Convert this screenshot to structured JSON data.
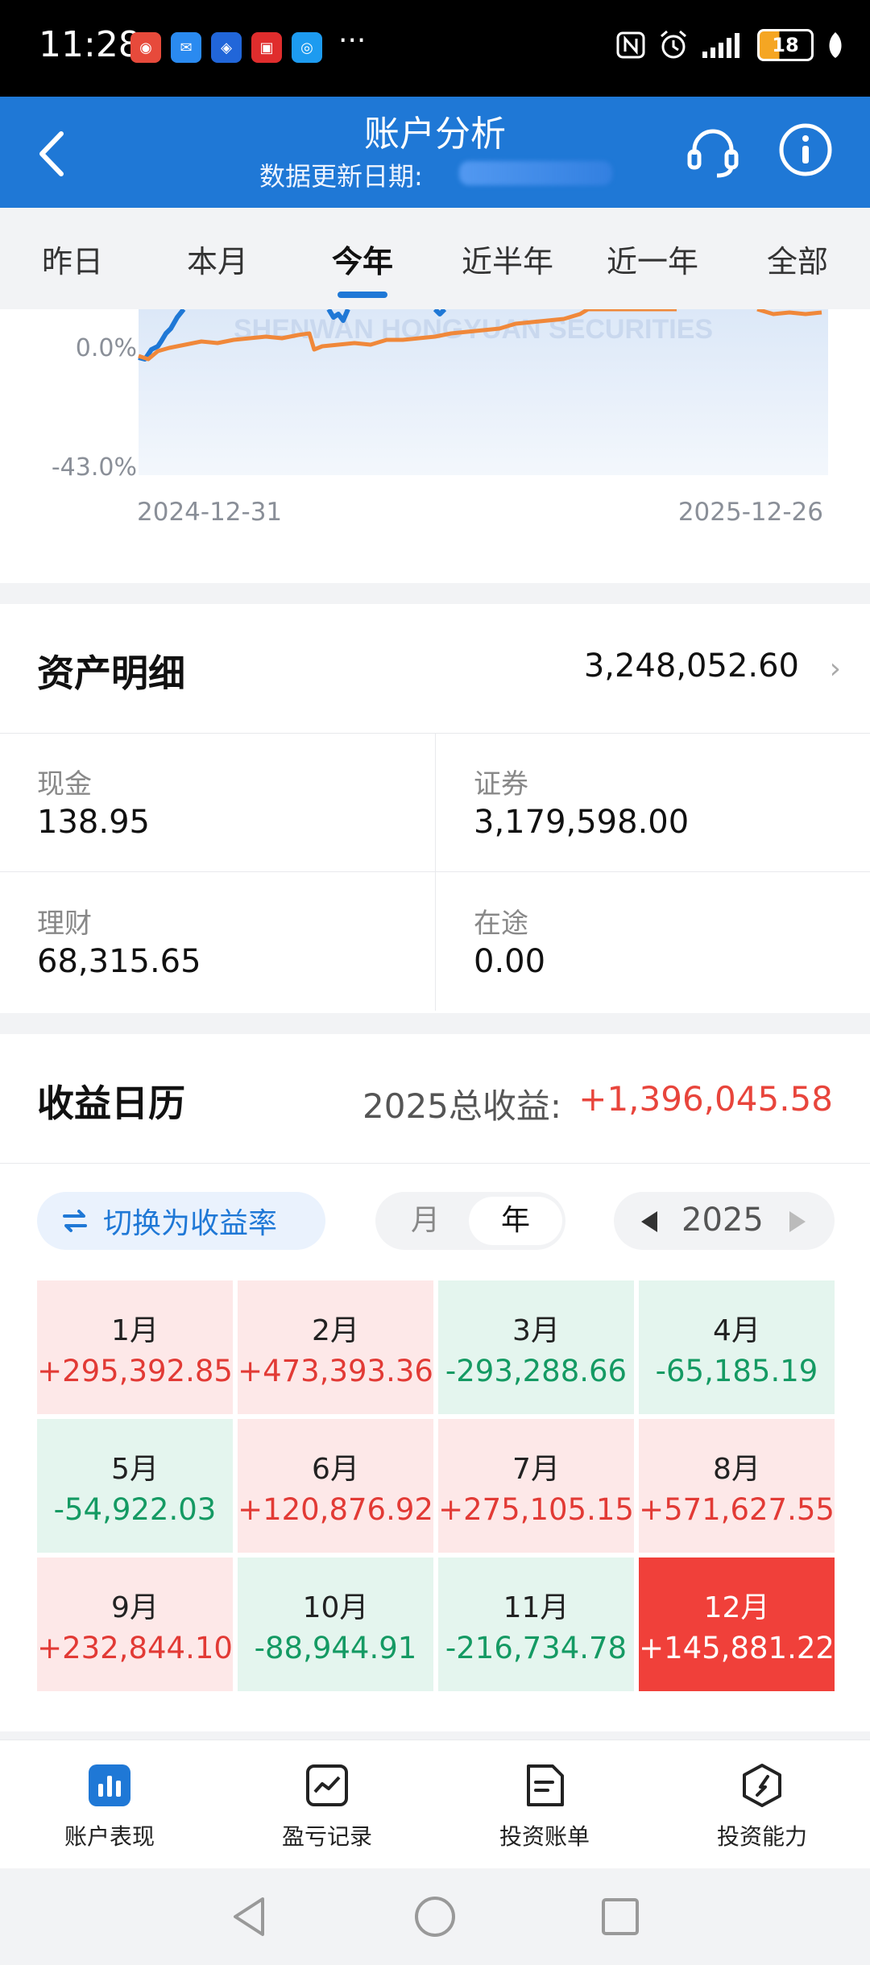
{
  "status_bar": {
    "time": "11:28",
    "battery": "18",
    "more_dots": "···"
  },
  "header": {
    "title": "账户分析",
    "update_label": "数据更新日期:"
  },
  "tabs": [
    {
      "label": "昨日",
      "active": false
    },
    {
      "label": "本月",
      "active": false
    },
    {
      "label": "今年",
      "active": true
    },
    {
      "label": "近半年",
      "active": false
    },
    {
      "label": "近一年",
      "active": false
    },
    {
      "label": "全部",
      "active": false
    }
  ],
  "chart_data": {
    "type": "line",
    "x_start_label": "2024-12-31",
    "x_end_label": "2025-12-26",
    "y_tick_labels": [
      "0.0%",
      "-43.0%"
    ],
    "series": [
      {
        "color": "#1f78d6"
      },
      {
        "color": "#f0883a"
      }
    ]
  },
  "assets": {
    "title": "资产明细",
    "total": "3,248,052.60",
    "items": [
      {
        "label": "现金",
        "value": "138.95"
      },
      {
        "label": "证券",
        "value": "3,179,598.00"
      },
      {
        "label": "理财",
        "value": "68,315.65"
      },
      {
        "label": "在途",
        "value": "0.00"
      }
    ]
  },
  "calendar": {
    "title": "收益日历",
    "total_label": "2025总收益:",
    "total_value": "+1,396,045.58",
    "switch_label": "切换为收益率",
    "seg_month": "月",
    "seg_year": "年",
    "year": "2025",
    "months": [
      {
        "name": "1月",
        "value": "+295,392.85",
        "type": "pos"
      },
      {
        "name": "2月",
        "value": "+473,393.36",
        "type": "pos"
      },
      {
        "name": "3月",
        "value": "-293,288.66",
        "type": "neg"
      },
      {
        "name": "4月",
        "value": "-65,185.19",
        "type": "neg"
      },
      {
        "name": "5月",
        "value": "-54,922.03",
        "type": "neg"
      },
      {
        "name": "6月",
        "value": "+120,876.92",
        "type": "pos"
      },
      {
        "name": "7月",
        "value": "+275,105.15",
        "type": "pos"
      },
      {
        "name": "8月",
        "value": "+571,627.55",
        "type": "pos"
      },
      {
        "name": "9月",
        "value": "+232,844.10",
        "type": "pos"
      },
      {
        "name": "10月",
        "value": "-88,944.91",
        "type": "neg"
      },
      {
        "name": "11月",
        "value": "-216,734.78",
        "type": "neg"
      },
      {
        "name": "12月",
        "value": "+145,881.22",
        "type": "hl"
      }
    ],
    "colors": {
      "positive": "#e23a35",
      "negative": "#149a63",
      "highlight": "#f0403a"
    }
  },
  "bottom_nav": [
    {
      "label": "账户表现",
      "icon": "bar-chart-icon",
      "active": true
    },
    {
      "label": "盈亏记录",
      "icon": "line-chart-icon",
      "active": false
    },
    {
      "label": "投资账单",
      "icon": "bill-icon",
      "active": false
    },
    {
      "label": "投资能力",
      "icon": "compass-icon",
      "active": false
    }
  ],
  "theme": {
    "primary": "#1f78d6"
  }
}
